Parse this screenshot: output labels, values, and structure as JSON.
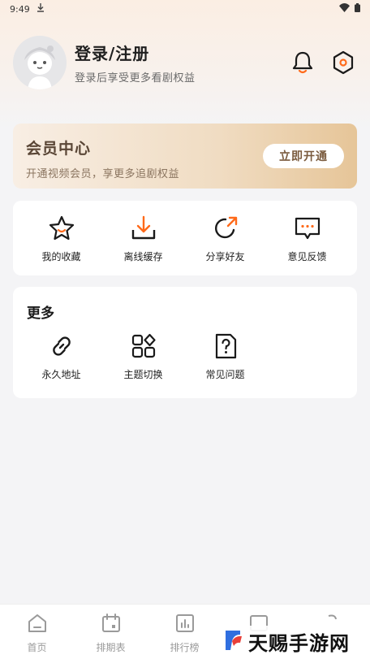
{
  "status_bar": {
    "time": "9:49"
  },
  "profile": {
    "title": "登录/注册",
    "subtitle": "登录后享受更多看剧权益"
  },
  "vip": {
    "title": "会员中心",
    "subtitle": "开通视频会员，享更多追剧权益",
    "button": "立即开通"
  },
  "quick_actions": [
    {
      "label": "我的收藏",
      "icon": "star-icon"
    },
    {
      "label": "离线缓存",
      "icon": "download-icon"
    },
    {
      "label": "分享好友",
      "icon": "share-icon"
    },
    {
      "label": "意见反馈",
      "icon": "feedback-icon"
    }
  ],
  "more": {
    "title": "更多",
    "items": [
      {
        "label": "永久地址",
        "icon": "link-icon"
      },
      {
        "label": "主题切换",
        "icon": "theme-icon"
      },
      {
        "label": "常见问题",
        "icon": "faq-icon"
      }
    ]
  },
  "tabbar": [
    {
      "label": "首页",
      "icon": "home-icon"
    },
    {
      "label": "排期表",
      "icon": "calendar-icon"
    },
    {
      "label": "排行榜",
      "icon": "ranking-icon"
    },
    {
      "label": "",
      "icon": "tab4-icon"
    },
    {
      "label": "",
      "icon": "tab5-icon"
    }
  ],
  "watermark": {
    "text": "天赐手游网"
  },
  "colors": {
    "accent": "#ff6a1a",
    "vip_text": "#5a4636",
    "tab_inactive": "#9a9a9a"
  }
}
